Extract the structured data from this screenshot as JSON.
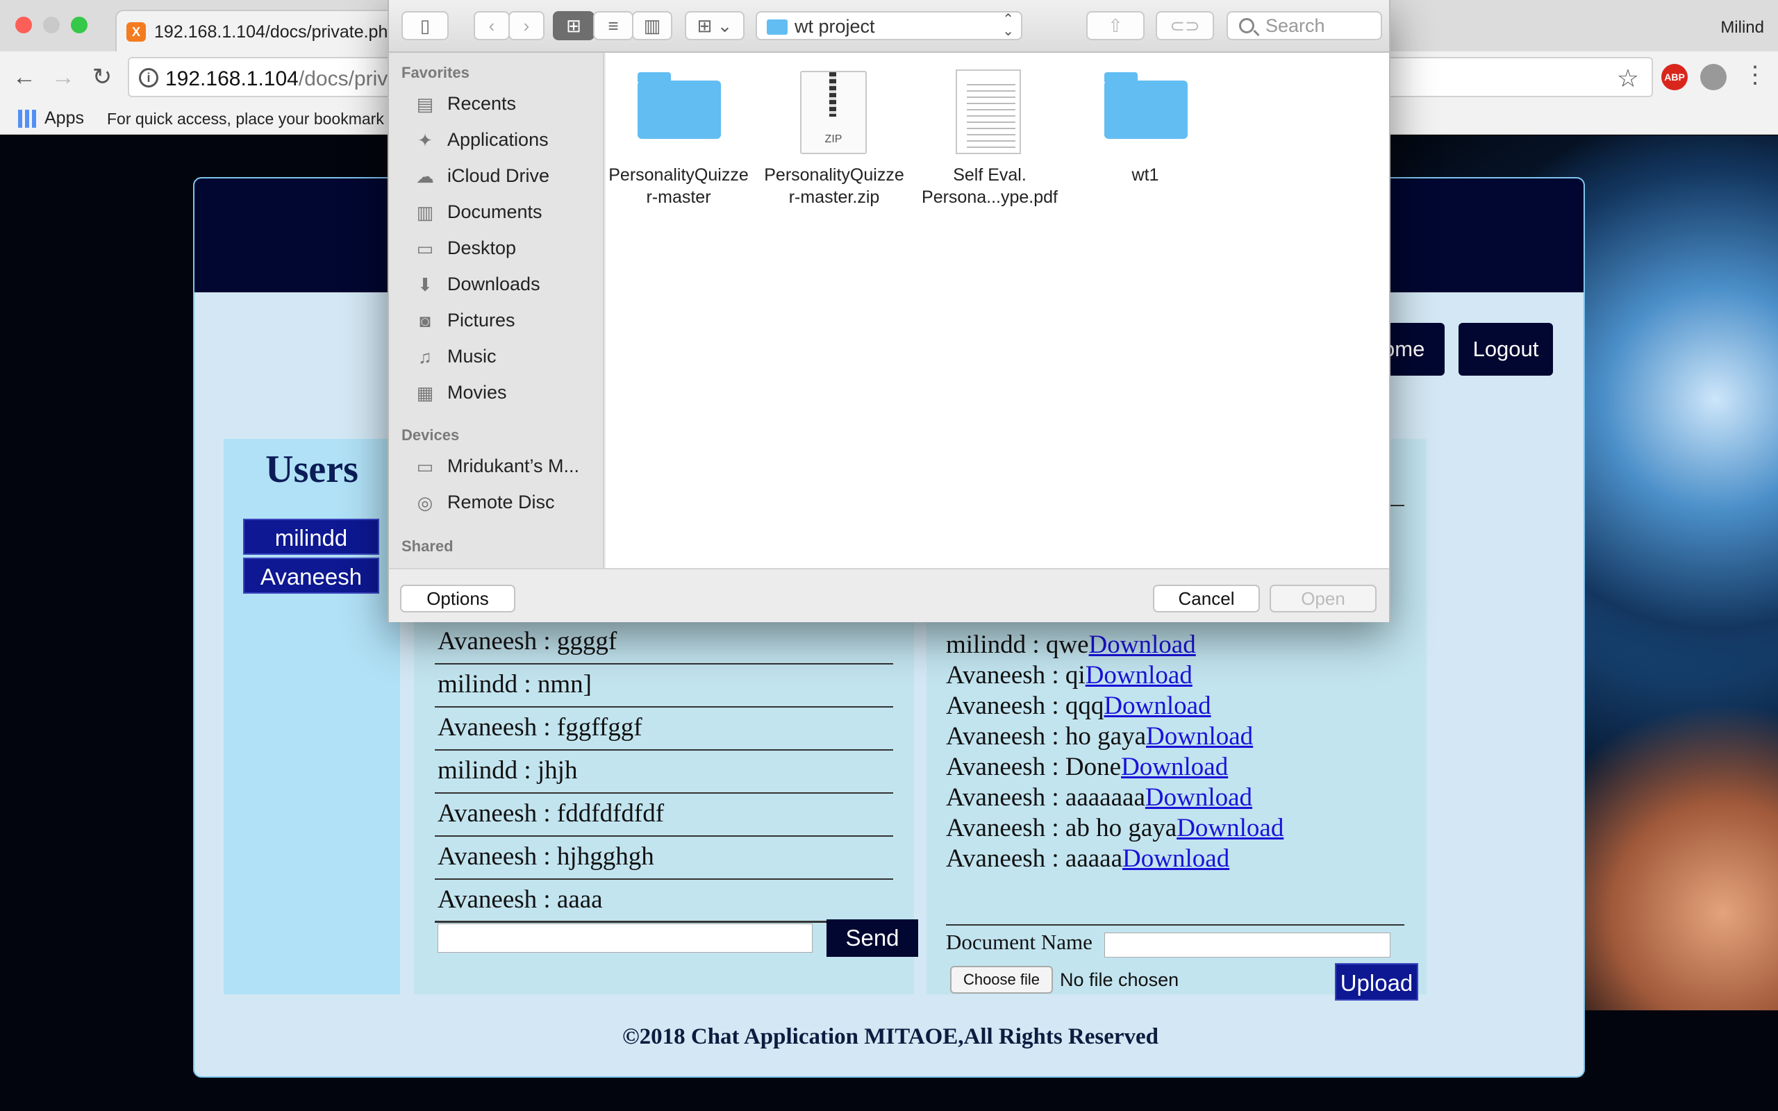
{
  "browser": {
    "tab_title": "192.168.1.104/docs/private.ph",
    "favicon_letter": "X",
    "profile_name": "Milind",
    "url_host": "192.168.1.104",
    "url_path": "/docs/priva",
    "abp_label": "ABP",
    "apps_label": "Apps",
    "bookmark_hint": "For quick access, place your bookmark"
  },
  "site": {
    "nav": {
      "home_label": "Home",
      "logout_label": "Logout"
    },
    "users_title": "Users",
    "users": [
      "milindd",
      "Avaneesh"
    ],
    "chat_messages": [
      "Avaneesh : ggggf",
      "milindd : nmn]",
      "Avaneesh : fggffggf",
      "milindd : jhjh",
      "Avaneesh : fddfdfdfdf",
      "Avaneesh : hjhgghgh",
      "Avaneesh : aaaa"
    ],
    "send_label": "Send",
    "documents": [
      {
        "text": "milindd : qwe",
        "link": "Download"
      },
      {
        "text": "Avaneesh : qi",
        "link": "Download"
      },
      {
        "text": "Avaneesh : qqq",
        "link": "Download"
      },
      {
        "text": "Avaneesh : ho gaya",
        "link": "Download"
      },
      {
        "text": "Avaneesh : Done",
        "link": "Download"
      },
      {
        "text": "Avaneesh : aaaaaaa",
        "link": "Download"
      },
      {
        "text": "Avaneesh : ab ho gaya",
        "link": "Download"
      },
      {
        "text": "Avaneesh : aaaaa",
        "link": "Download"
      }
    ],
    "document_name_label": "Document Name",
    "choose_file_label": "Choose file",
    "no_file_label": "No file chosen",
    "upload_label": "Upload",
    "footer": "©2018 Chat Application MITAOE,All Rights Reserved"
  },
  "dialog": {
    "location": "wt project",
    "search_placeholder": "Search",
    "favorites_heading": "Favorites",
    "favorites": [
      {
        "label": "Recents",
        "icon": "recents-icon",
        "glyph": "▤"
      },
      {
        "label": "Applications",
        "icon": "applications-icon",
        "glyph": "✦"
      },
      {
        "label": "iCloud Drive",
        "icon": "icloud-icon",
        "glyph": "☁"
      },
      {
        "label": "Documents",
        "icon": "documents-icon",
        "glyph": "▥"
      },
      {
        "label": "Desktop",
        "icon": "desktop-icon",
        "glyph": "▭"
      },
      {
        "label": "Downloads",
        "icon": "downloads-icon",
        "glyph": "⬇"
      },
      {
        "label": "Pictures",
        "icon": "camera-icon",
        "glyph": "◙"
      },
      {
        "label": "Music",
        "icon": "music-icon",
        "glyph": "♫"
      },
      {
        "label": "Movies",
        "icon": "film-icon",
        "glyph": "▦"
      }
    ],
    "devices_heading": "Devices",
    "devices": [
      {
        "label": "Mridukant’s M...",
        "icon": "laptop-icon",
        "glyph": "▭"
      },
      {
        "label": "Remote Disc",
        "icon": "disc-icon",
        "glyph": "◎"
      }
    ],
    "shared_heading": "Shared",
    "files": [
      {
        "name": "PersonalityQuizze r-master",
        "kind": "folder"
      },
      {
        "name": "PersonalityQuizze r-master.zip",
        "kind": "zip",
        "badge": "ZIP"
      },
      {
        "name": "Self Eval. Persona...ype.pdf",
        "kind": "pdf"
      },
      {
        "name": "wt1",
        "kind": "folder"
      }
    ],
    "options_label": "Options",
    "cancel_label": "Cancel",
    "open_label": "Open"
  },
  "colors": {
    "site_header": "#010730",
    "user_button": "#0d1892",
    "panel_bg": "#d3e8f4",
    "folder_blue": "#61bdf2",
    "link": "#1a12d8"
  }
}
